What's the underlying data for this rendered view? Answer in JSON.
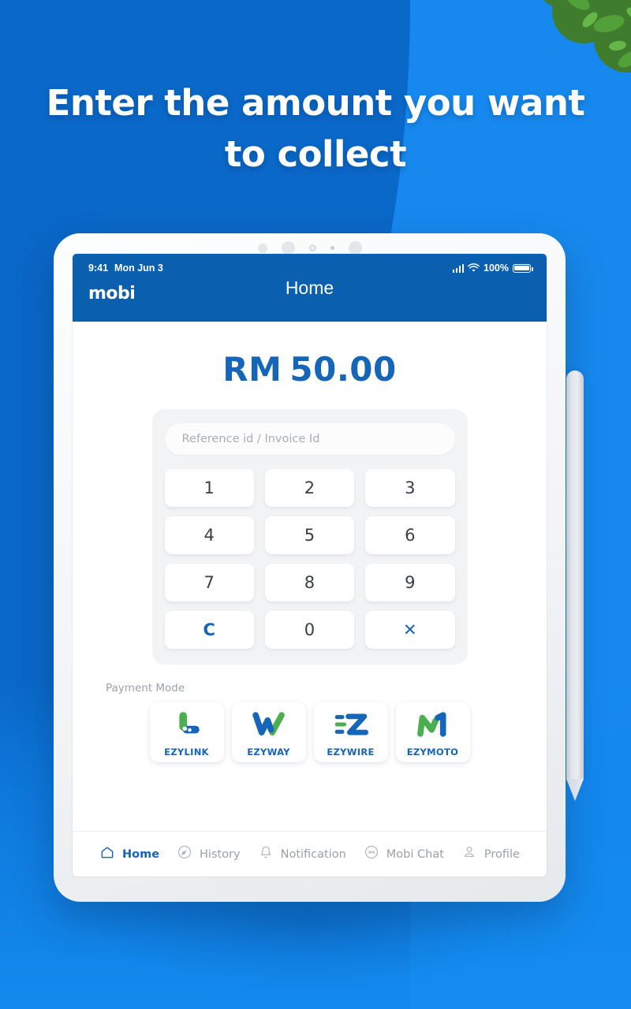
{
  "promo": {
    "headline_line1": "Enter the amount you want",
    "headline_line2": "to collect"
  },
  "device": {
    "status_time": "9:41",
    "status_date": "Mon Jun 3",
    "battery_percent": "100%"
  },
  "app": {
    "brand": "mobi",
    "page_title": "Home",
    "amount": {
      "currency": "RM",
      "value": "50.00"
    },
    "reference_placeholder": "Reference id / Invoice Id",
    "keypad": [
      {
        "label": "1",
        "kind": "digit"
      },
      {
        "label": "2",
        "kind": "digit"
      },
      {
        "label": "3",
        "kind": "digit"
      },
      {
        "label": "4",
        "kind": "digit"
      },
      {
        "label": "5",
        "kind": "digit"
      },
      {
        "label": "6",
        "kind": "digit"
      },
      {
        "label": "7",
        "kind": "digit"
      },
      {
        "label": "8",
        "kind": "digit"
      },
      {
        "label": "9",
        "kind": "digit"
      },
      {
        "label": "C",
        "kind": "clear"
      },
      {
        "label": "0",
        "kind": "digit"
      },
      {
        "label": "✕",
        "kind": "close"
      }
    ],
    "payment_mode_label": "Payment Mode",
    "payment_modes": [
      {
        "name": "EZYLINK",
        "icon": "ezylink-logo"
      },
      {
        "name": "EZYWAY",
        "icon": "ezyway-logo"
      },
      {
        "name": "EZYWIRE",
        "icon": "ezywire-logo"
      },
      {
        "name": "EZYMOTO",
        "icon": "ezymoto-logo"
      }
    ],
    "nav": [
      {
        "label": "Home",
        "icon": "home-icon",
        "active": true
      },
      {
        "label": "History",
        "icon": "compass-icon",
        "active": false
      },
      {
        "label": "Notification",
        "icon": "bell-icon",
        "active": false
      },
      {
        "label": "Mobi Chat",
        "icon": "chat-icon",
        "active": false
      },
      {
        "label": "Profile",
        "icon": "person-icon",
        "active": false
      }
    ]
  },
  "colors": {
    "brand_blue": "#0a5fae",
    "accent_blue": "#1565b8",
    "logo_green": "#4caf4f",
    "bg_dark": "#0a68c8",
    "bg_light": "#1789ee"
  }
}
